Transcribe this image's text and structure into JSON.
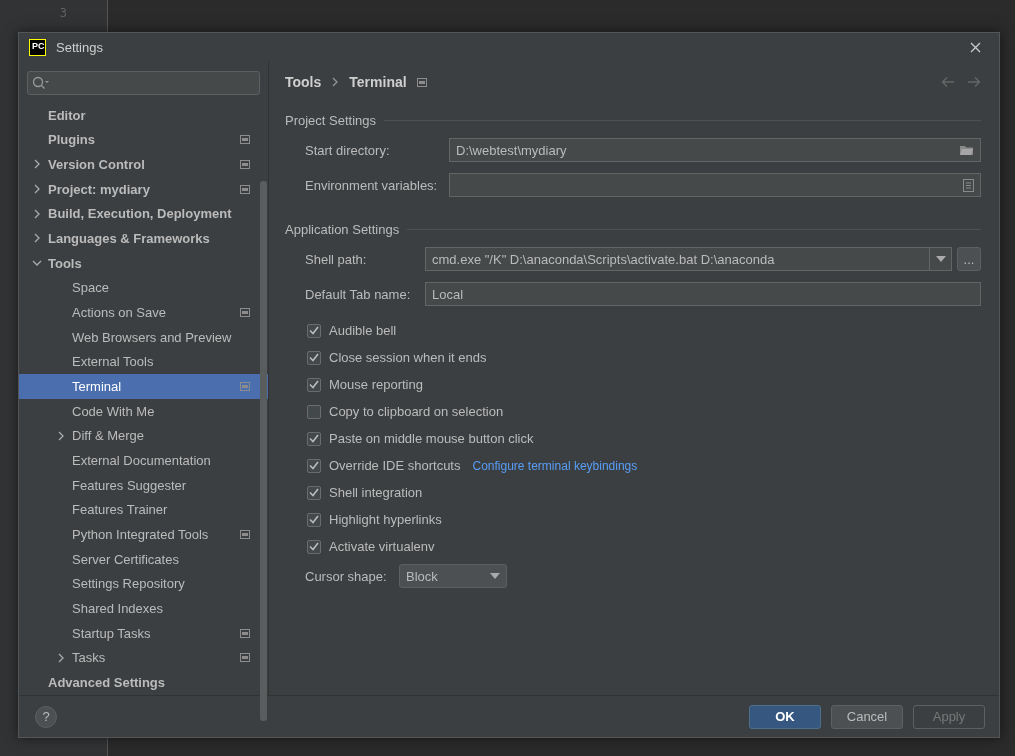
{
  "editor": {
    "line_number": "3"
  },
  "window": {
    "title": "Settings",
    "logo": "PC"
  },
  "sidebar": {
    "items": [
      {
        "label": "Editor",
        "kind": "leaf",
        "project_level": false,
        "selected": false
      },
      {
        "label": "Plugins",
        "kind": "leaf",
        "project_level": true,
        "selected": false
      },
      {
        "label": "Version Control",
        "kind": "folder",
        "expanded": false,
        "project_level": true,
        "selected": false
      },
      {
        "label": "Project: mydiary",
        "kind": "folder",
        "expanded": false,
        "project_level": true,
        "selected": false
      },
      {
        "label": "Build, Execution, Deployment",
        "kind": "folder",
        "expanded": false,
        "project_level": false,
        "selected": false
      },
      {
        "label": "Languages & Frameworks",
        "kind": "folder",
        "expanded": false,
        "project_level": false,
        "selected": false
      },
      {
        "label": "Tools",
        "kind": "folder",
        "expanded": true,
        "project_level": false,
        "selected": false,
        "children": [
          {
            "label": "Space",
            "kind": "leaf",
            "project_level": false,
            "selected": false
          },
          {
            "label": "Actions on Save",
            "kind": "leaf",
            "project_level": true,
            "selected": false
          },
          {
            "label": "Web Browsers and Preview",
            "kind": "leaf",
            "project_level": false,
            "selected": false
          },
          {
            "label": "External Tools",
            "kind": "leaf",
            "project_level": false,
            "selected": false
          },
          {
            "label": "Terminal",
            "kind": "leaf",
            "project_level": true,
            "selected": true
          },
          {
            "label": "Code With Me",
            "kind": "leaf",
            "project_level": false,
            "selected": false
          },
          {
            "label": "Diff & Merge",
            "kind": "folder",
            "expanded": false,
            "project_level": false,
            "selected": false
          },
          {
            "label": "External Documentation",
            "kind": "leaf",
            "project_level": false,
            "selected": false
          },
          {
            "label": "Features Suggester",
            "kind": "leaf",
            "project_level": false,
            "selected": false
          },
          {
            "label": "Features Trainer",
            "kind": "leaf",
            "project_level": false,
            "selected": false
          },
          {
            "label": "Python Integrated Tools",
            "kind": "leaf",
            "project_level": true,
            "selected": false
          },
          {
            "label": "Server Certificates",
            "kind": "leaf",
            "project_level": false,
            "selected": false
          },
          {
            "label": "Settings Repository",
            "kind": "leaf",
            "project_level": false,
            "selected": false
          },
          {
            "label": "Shared Indexes",
            "kind": "leaf",
            "project_level": false,
            "selected": false
          },
          {
            "label": "Startup Tasks",
            "kind": "leaf",
            "project_level": true,
            "selected": false
          },
          {
            "label": "Tasks",
            "kind": "folder",
            "expanded": false,
            "project_level": true,
            "selected": false
          }
        ]
      },
      {
        "label": "Advanced Settings",
        "kind": "leaf",
        "project_level": false,
        "selected": false
      }
    ]
  },
  "breadcrumb": [
    "Tools",
    "Terminal"
  ],
  "project_settings": {
    "title": "Project Settings",
    "start_directory": {
      "label": "Start directory:",
      "value": "D:\\webtest\\mydiary"
    },
    "environment_variables": {
      "label": "Environment variables:"
    }
  },
  "application_settings": {
    "title": "Application Settings",
    "shell_path": {
      "label": "Shell path:",
      "value": "cmd.exe \"/K\" D:\\anaconda\\Scripts\\activate.bat D:\\anaconda",
      "browse": "..."
    },
    "default_tab_name": {
      "label": "Default Tab name:",
      "value": "Local"
    },
    "options": [
      {
        "label": "Audible bell",
        "checked": true
      },
      {
        "label": "Close session when it ends",
        "checked": true
      },
      {
        "label": "Mouse reporting",
        "checked": true
      },
      {
        "label": "Copy to clipboard on selection",
        "checked": false
      },
      {
        "label": "Paste on middle mouse button click",
        "checked": true
      },
      {
        "label": "Override IDE shortcuts",
        "checked": true,
        "link": "Configure terminal keybindings"
      },
      {
        "label": "Shell integration",
        "checked": true
      },
      {
        "label": "Highlight hyperlinks",
        "checked": true
      },
      {
        "label": "Activate virtualenv",
        "checked": true
      }
    ],
    "cursor_shape": {
      "label": "Cursor shape:",
      "value": "Block"
    }
  },
  "footer": {
    "help": "?",
    "buttons": [
      {
        "label": "OK",
        "kind": "primary",
        "disabled": false
      },
      {
        "label": "Cancel",
        "kind": "normal",
        "disabled": false
      },
      {
        "label": "Apply",
        "kind": "normal",
        "disabled": true
      }
    ]
  }
}
